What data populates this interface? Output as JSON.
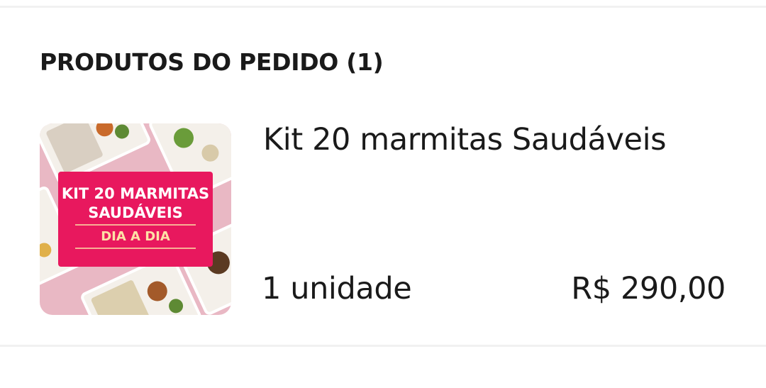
{
  "section": {
    "title": "PRODUTOS DO PEDIDO (1)"
  },
  "product": {
    "name": "Kit 20 marmitas Saudáveis",
    "quantity": "1 unidade",
    "price": "R$ 290,00",
    "image": {
      "line1": "KIT 20 MARMITAS",
      "line2": "SAUDÁVEIS",
      "line3": "DIA A DIA"
    }
  },
  "colors": {
    "banner_pink": "#e8185e",
    "background_pink": "#e9b8c4",
    "banner_subtext": "#fde1a6"
  }
}
